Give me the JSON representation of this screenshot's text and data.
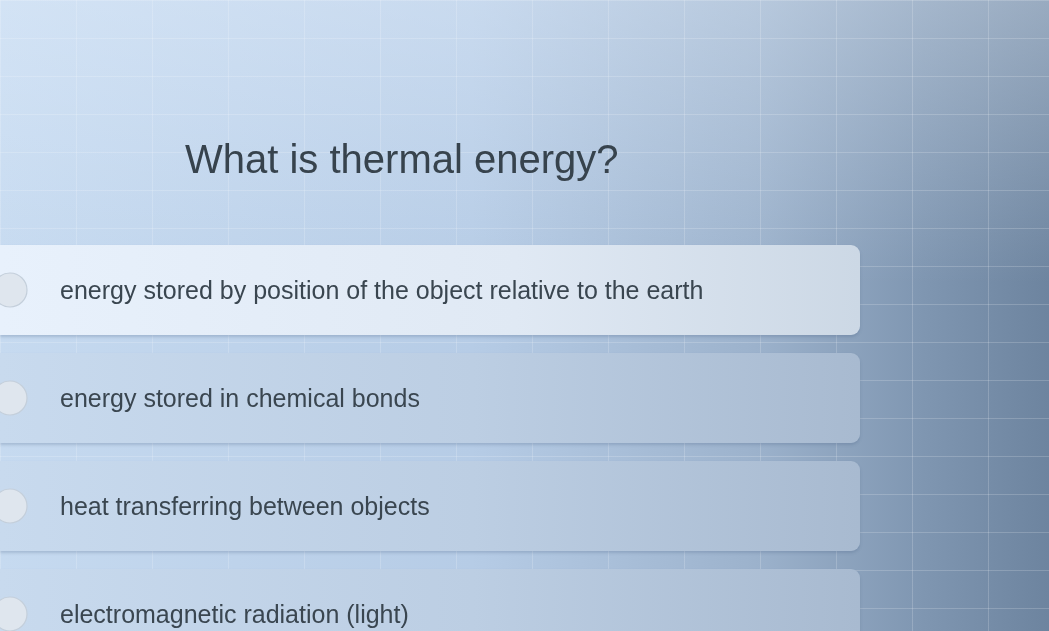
{
  "question": {
    "text": "What is thermal energy?"
  },
  "options": [
    {
      "label": "energy stored by position of the object relative to the earth",
      "selected": false,
      "hovered": true
    },
    {
      "label": "energy stored in chemical bonds",
      "selected": false,
      "hovered": false
    },
    {
      "label": "heat transferring between objects",
      "selected": false,
      "hovered": false
    },
    {
      "label": "electromagnetic radiation (light)",
      "selected": false,
      "hovered": false
    }
  ]
}
